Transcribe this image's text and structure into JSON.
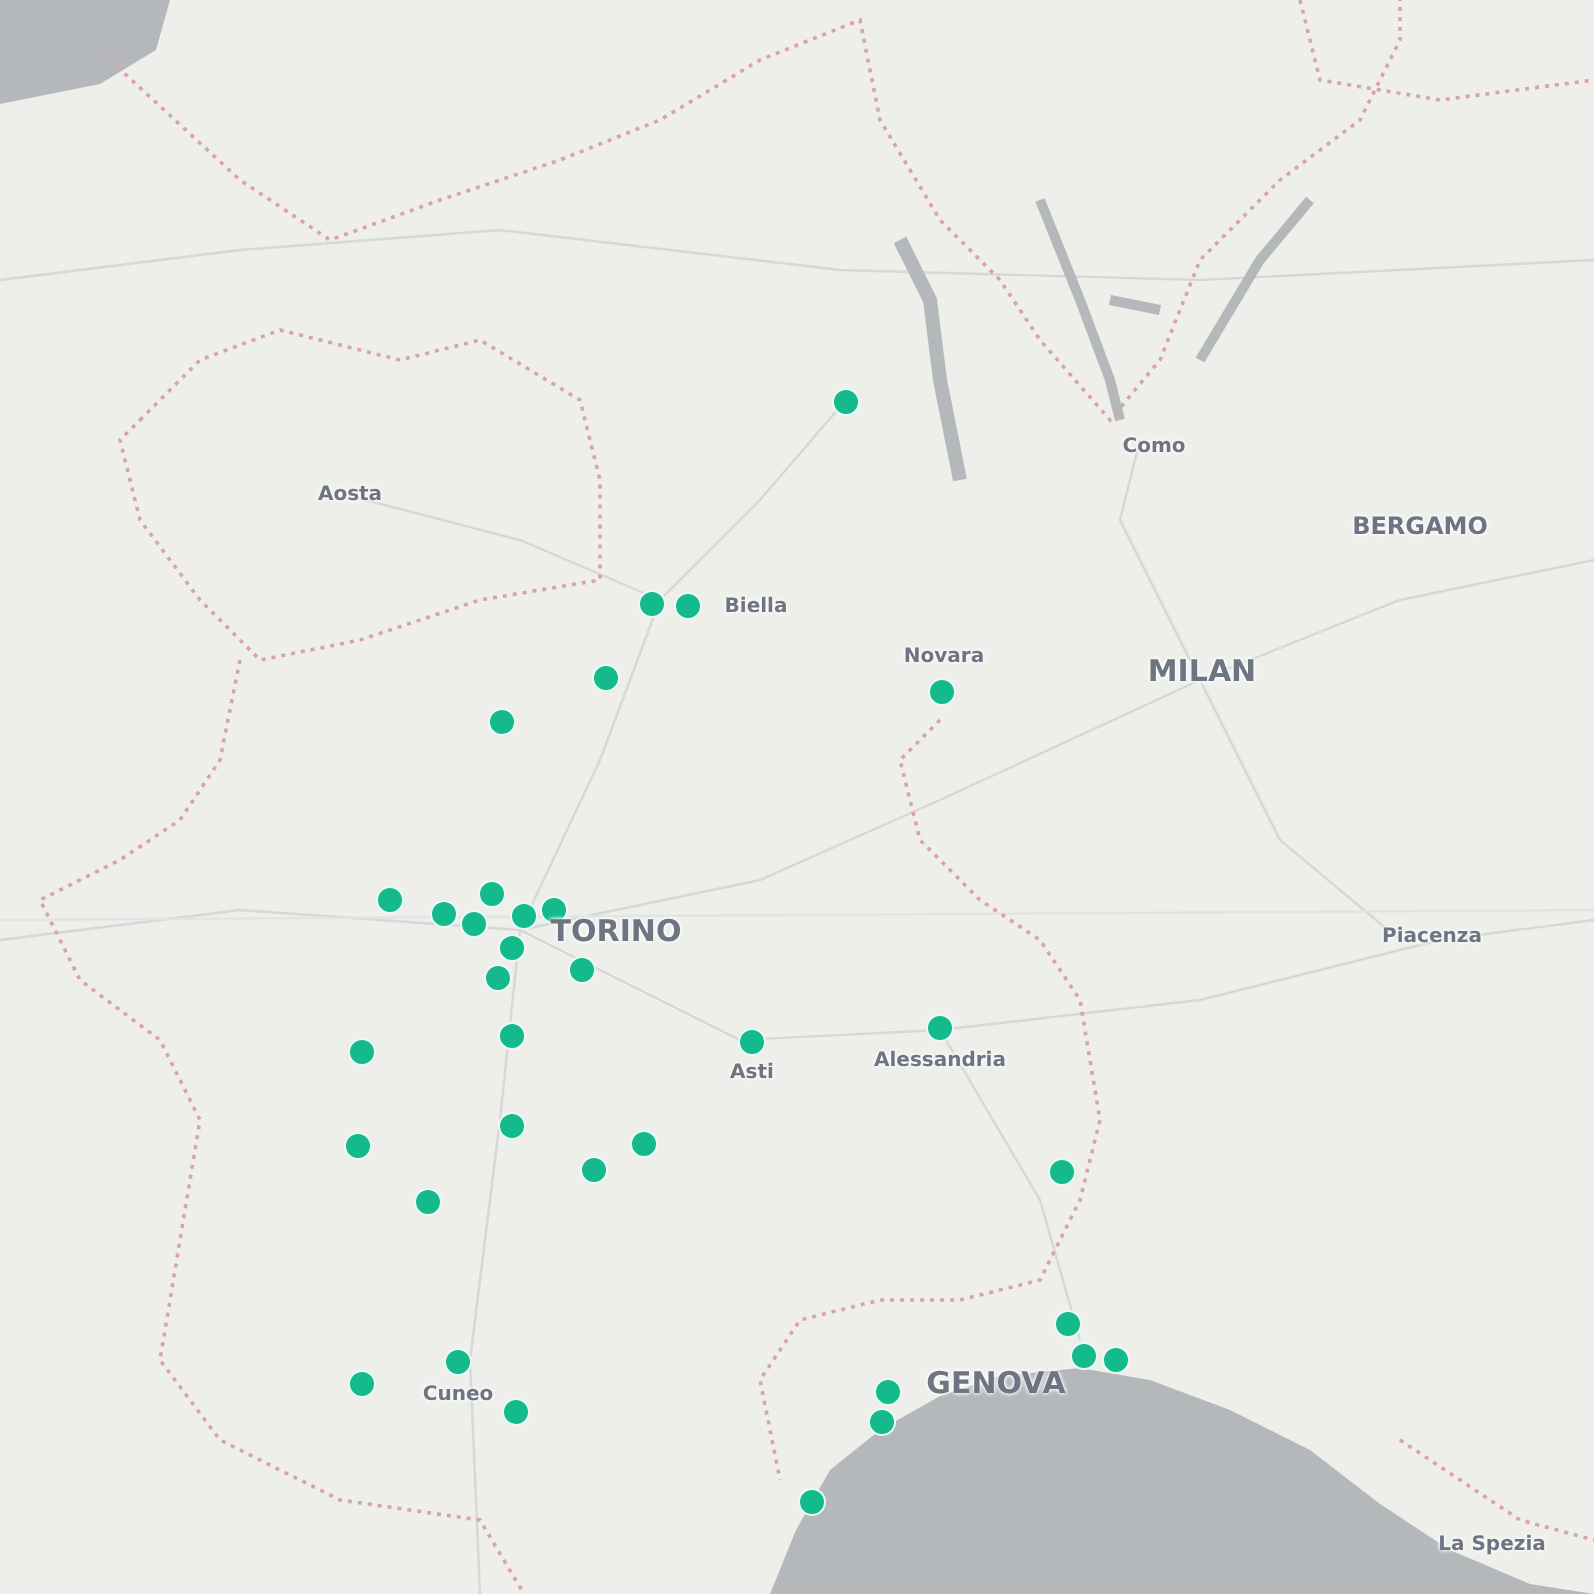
{
  "map": {
    "labels": [
      {
        "text": "Como",
        "kind": "small"
      },
      {
        "text": "Aosta",
        "kind": "small"
      },
      {
        "text": "BERGAMO",
        "kind": "medium"
      },
      {
        "text": "Biella",
        "kind": "small"
      },
      {
        "text": "Novara",
        "kind": "small"
      },
      {
        "text": "MILAN",
        "kind": "large"
      },
      {
        "text": "TORINO",
        "kind": "large"
      },
      {
        "text": "Piacenza",
        "kind": "small"
      },
      {
        "text": "Asti",
        "kind": "small"
      },
      {
        "text": "Alessandria",
        "kind": "small"
      },
      {
        "text": "Cuneo",
        "kind": "small"
      },
      {
        "text": "GENOVA",
        "kind": "large"
      },
      {
        "text": "La Spezia",
        "kind": "small"
      }
    ]
  }
}
